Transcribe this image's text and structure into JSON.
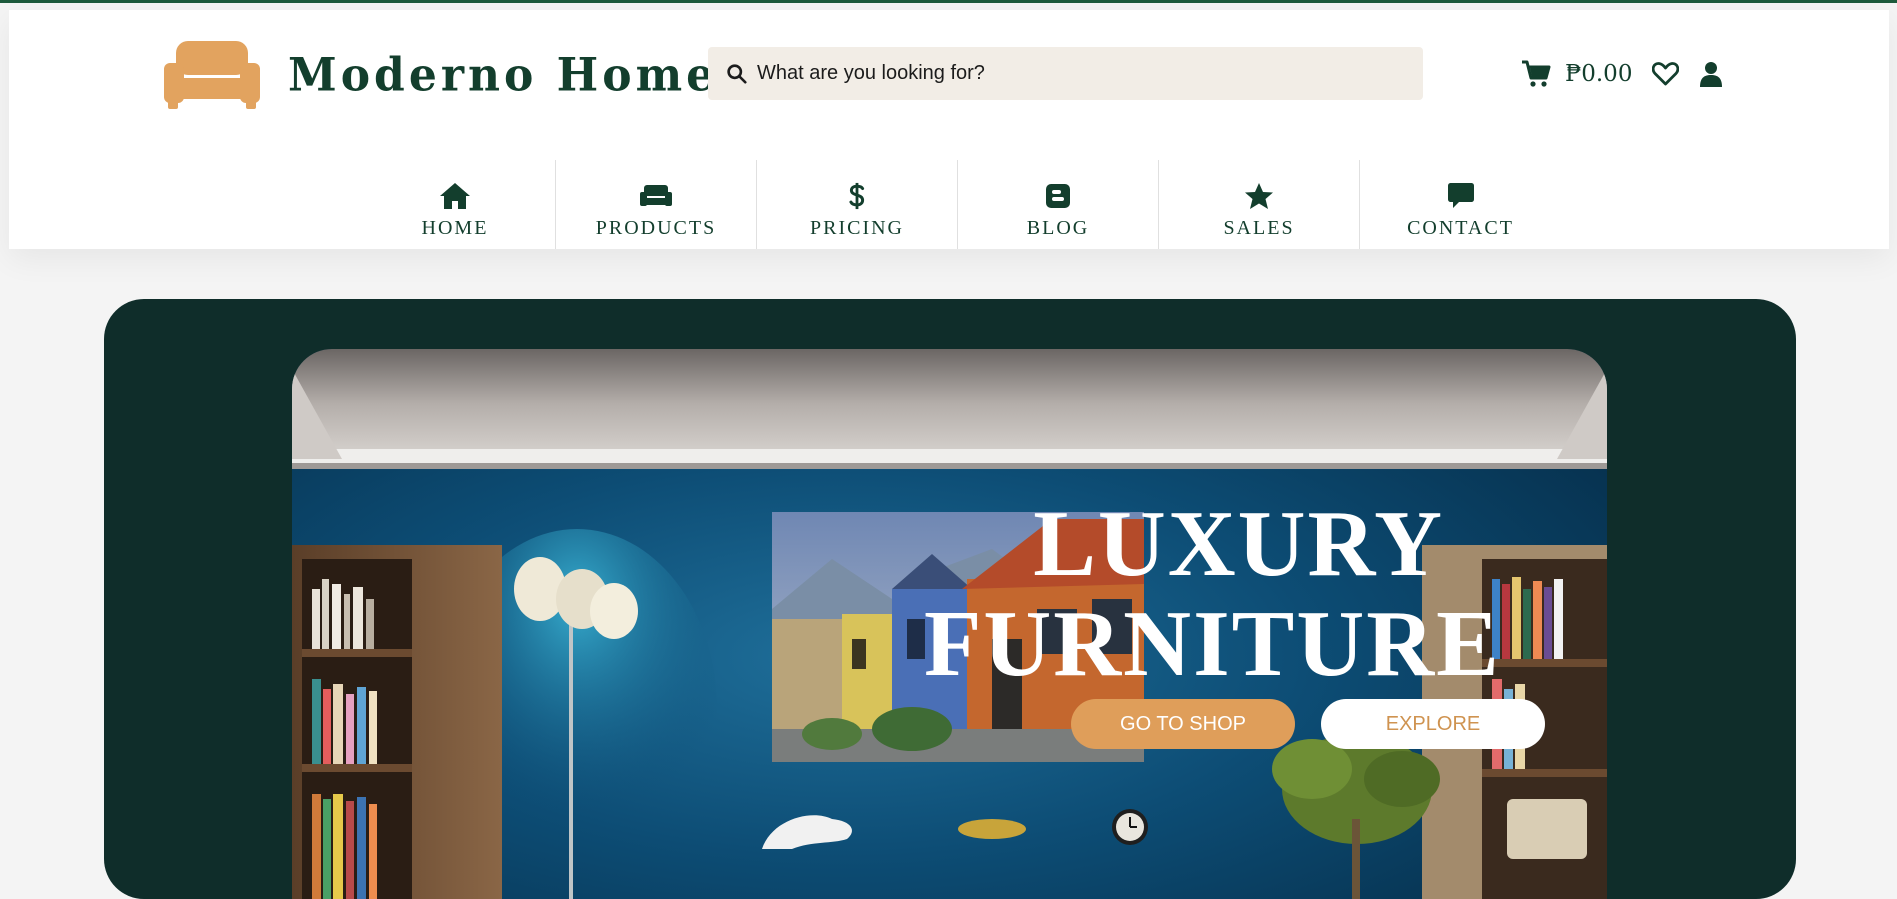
{
  "brand": {
    "name": "Moderno Home",
    "logo_color": "#e2a35f",
    "primary_color": "#133e2d"
  },
  "search": {
    "placeholder": "What are you looking for?",
    "icon": "search-icon"
  },
  "actions": {
    "cart_icon": "cart-icon",
    "cart_total": "₱0.00",
    "wishlist_icon": "heart-icon",
    "account_icon": "user-icon"
  },
  "nav": {
    "items": [
      {
        "label": "HOME",
        "icon": "home-icon"
      },
      {
        "label": "PRODUCTS",
        "icon": "sofa-icon"
      },
      {
        "label": "PRICING",
        "icon": "dollar-icon"
      },
      {
        "label": "BLOG",
        "icon": "blogger-icon"
      },
      {
        "label": "SALES",
        "icon": "star-icon"
      },
      {
        "label": "CONTACT",
        "icon": "chat-icon"
      }
    ]
  },
  "hero": {
    "headline_line1": "LUXURY",
    "headline_line2": "FURNITURE",
    "primary_button": "GO TO SHOP",
    "secondary_button": "EXPLORE",
    "background_color": "#0f2d2a",
    "primary_button_color": "#df9e5a"
  }
}
